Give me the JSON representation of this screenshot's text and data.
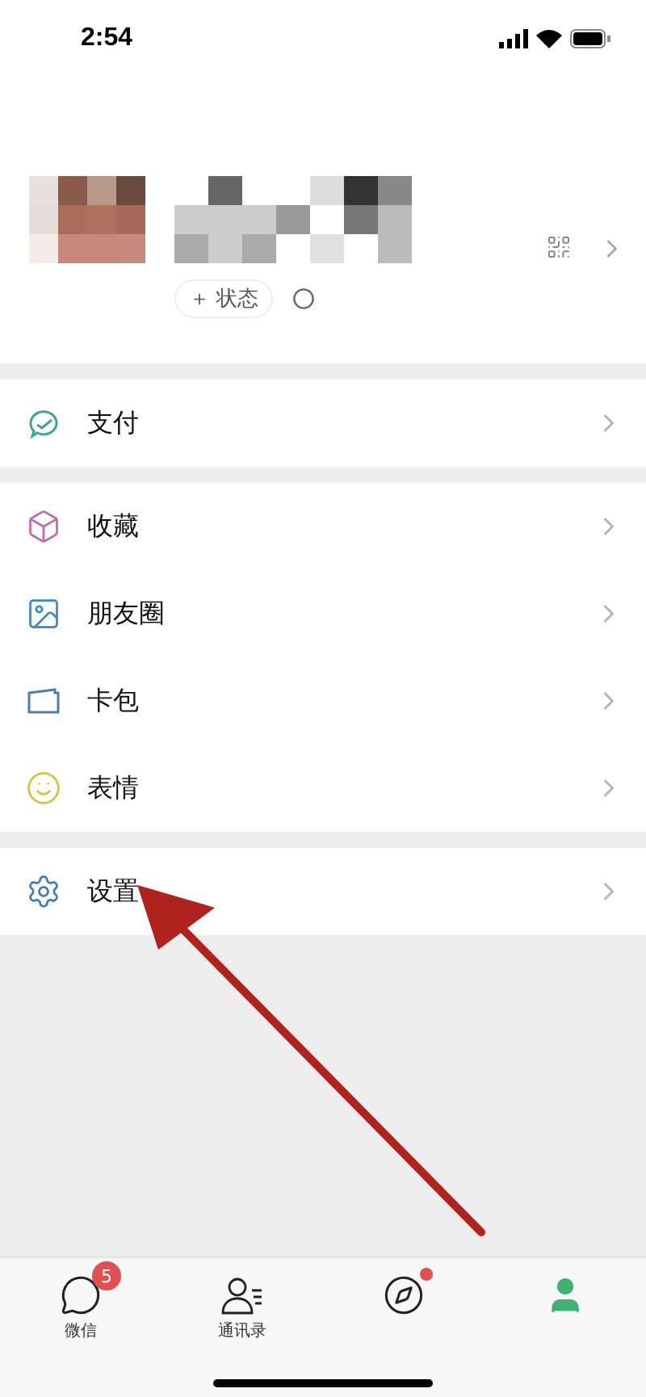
{
  "status_bar": {
    "time": "2:54"
  },
  "profile": {
    "status_button": "＋ 状态"
  },
  "menu_groups": [
    [
      {
        "label": "支付",
        "kind": "pay"
      }
    ],
    [
      {
        "label": "收藏",
        "kind": "favorites"
      },
      {
        "label": "朋友圈",
        "kind": "moments"
      },
      {
        "label": "卡包",
        "kind": "cards"
      },
      {
        "label": "表情",
        "kind": "stickers"
      }
    ],
    [
      {
        "label": "设置",
        "kind": "settings"
      }
    ]
  ],
  "annotation": {
    "kind": "arrow"
  },
  "tab_bar": [
    {
      "kind": "chats",
      "label": "微信",
      "selected": false,
      "badge": "5",
      "dot": false
    },
    {
      "kind": "contacts",
      "label": "通讯录",
      "selected": false,
      "dot": false
    },
    {
      "kind": "discover",
      "selected": false,
      "dot": true
    },
    {
      "kind": "me",
      "selected": true,
      "dot": false
    }
  ]
}
